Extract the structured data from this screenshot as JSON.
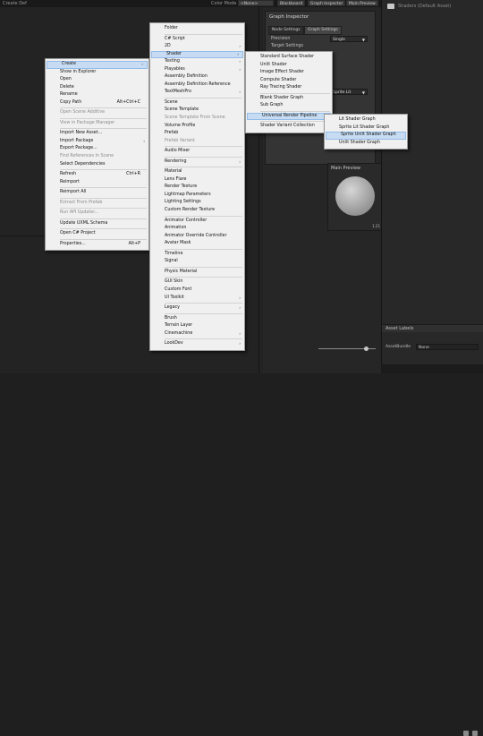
{
  "topbar": {
    "title": "Create Def",
    "color_mode_label": "Color Mode",
    "color_mode_value": "<None>",
    "buttons": [
      "Blackboard",
      "Graph Inspector",
      "Main Preview"
    ]
  },
  "inspector": {
    "title": "Graph Inspector",
    "tabs": [
      "Node Settings",
      "Graph Settings"
    ],
    "precision_label": "Precision",
    "precision_value": "Single",
    "target_label": "Target Settings",
    "target_value": "Sprite Lit"
  },
  "main_preview": {
    "title": "Main Preview",
    "scale": "1.21"
  },
  "project": {
    "breadcrumb": "Shaders (Default Asset)",
    "asset_labels": "Asset Labels",
    "asset_bundle_label": "AssetBundle",
    "asset_bundle_value": "None"
  },
  "context_menu": [
    {
      "label": "Create",
      "submenu": true,
      "highlighted": true
    },
    {
      "label": "Show in Explorer"
    },
    {
      "label": "Open"
    },
    {
      "label": "Delete"
    },
    {
      "label": "Rename"
    },
    {
      "label": "Copy Path",
      "shortcut": "Alt+Ctrl+C"
    },
    {
      "sep": true
    },
    {
      "label": "Open Scene Additive",
      "disabled": true
    },
    {
      "sep": true
    },
    {
      "label": "View in Package Manager",
      "disabled": true
    },
    {
      "sep": true
    },
    {
      "label": "Import New Asset..."
    },
    {
      "label": "Import Package",
      "submenu": true
    },
    {
      "label": "Export Package..."
    },
    {
      "label": "Find References In Scene",
      "disabled": true
    },
    {
      "label": "Select Dependencies"
    },
    {
      "sep": true
    },
    {
      "label": "Refresh",
      "shortcut": "Ctrl+R"
    },
    {
      "label": "Reimport"
    },
    {
      "sep": true
    },
    {
      "label": "Reimport All"
    },
    {
      "sep": true
    },
    {
      "label": "Extract From Prefab",
      "disabled": true
    },
    {
      "sep": true
    },
    {
      "label": "Run API Updater...",
      "disabled": true
    },
    {
      "sep": true
    },
    {
      "label": "Update UXML Schema"
    },
    {
      "sep": true
    },
    {
      "label": "Open C# Project"
    },
    {
      "sep": true
    },
    {
      "label": "Properties...",
      "shortcut": "Alt+P"
    }
  ],
  "create_menu": [
    {
      "label": "Folder"
    },
    {
      "sep": true
    },
    {
      "label": "C# Script"
    },
    {
      "label": "2D",
      "submenu": true
    },
    {
      "label": "Shader",
      "submenu": true,
      "highlighted": true
    },
    {
      "label": "Testing",
      "submenu": true
    },
    {
      "label": "Playables",
      "submenu": true
    },
    {
      "label": "Assembly Definition"
    },
    {
      "label": "Assembly Definition Reference"
    },
    {
      "label": "TextMeshPro",
      "submenu": true
    },
    {
      "sep": true
    },
    {
      "label": "Scene"
    },
    {
      "label": "Scene Template"
    },
    {
      "label": "Scene Template From Scene",
      "disabled": true
    },
    {
      "label": "Volume Profile"
    },
    {
      "label": "Prefab"
    },
    {
      "label": "Prefab Variant",
      "disabled": true
    },
    {
      "sep": true
    },
    {
      "label": "Audio Mixer"
    },
    {
      "sep": true
    },
    {
      "label": "Rendering",
      "submenu": true
    },
    {
      "sep": true
    },
    {
      "label": "Material"
    },
    {
      "label": "Lens Flare"
    },
    {
      "label": "Render Texture"
    },
    {
      "label": "Lightmap Parameters"
    },
    {
      "label": "Lighting Settings"
    },
    {
      "label": "Custom Render Texture"
    },
    {
      "sep": true
    },
    {
      "label": "Animator Controller"
    },
    {
      "label": "Animation"
    },
    {
      "label": "Animator Override Controller"
    },
    {
      "label": "Avatar Mask"
    },
    {
      "sep": true
    },
    {
      "label": "Timeline"
    },
    {
      "label": "Signal"
    },
    {
      "sep": true
    },
    {
      "label": "Physic Material"
    },
    {
      "sep": true
    },
    {
      "label": "GUI Skin"
    },
    {
      "label": "Custom Font"
    },
    {
      "label": "UI Toolkit",
      "submenu": true
    },
    {
      "sep": true
    },
    {
      "label": "Legacy",
      "submenu": true
    },
    {
      "sep": true
    },
    {
      "label": "Brush"
    },
    {
      "label": "Terrain Layer"
    },
    {
      "label": "Cinemachine",
      "submenu": true
    },
    {
      "sep": true
    },
    {
      "label": "LookDev",
      "submenu": true
    }
  ],
  "shader_menu": [
    {
      "label": "Standard Surface Shader"
    },
    {
      "label": "Unlit Shader"
    },
    {
      "label": "Image Effect Shader"
    },
    {
      "label": "Compute Shader"
    },
    {
      "label": "Ray Tracing Shader"
    },
    {
      "sep": true
    },
    {
      "label": "Blank Shader Graph"
    },
    {
      "label": "Sub Graph"
    },
    {
      "sep": true
    },
    {
      "label": "Universal Render Pipeline",
      "submenu": true,
      "highlighted": true
    },
    {
      "sep": true
    },
    {
      "label": "Shader Variant Collection"
    }
  ],
  "urp_menu": [
    {
      "label": "Lit Shader Graph"
    },
    {
      "label": "Sprite Lit Shader Graph"
    },
    {
      "label": "Sprite Unlit Shader Graph",
      "highlighted": true
    },
    {
      "label": "Unlit Shader Graph"
    }
  ]
}
